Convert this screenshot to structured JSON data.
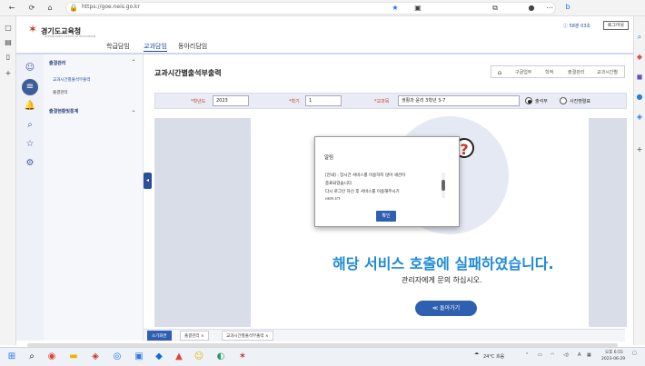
{
  "browser": {
    "url": "https://goe.neis.go.kr",
    "tab_label": "gae"
  },
  "header": {
    "logo": "경기도교육청",
    "logo_sub": "GYEONGGIDO OFFICE OF EDUCATION",
    "nav": [
      "학급담임",
      "교과담임",
      "동아리담임"
    ],
    "user": "ⓘ 58분 03초",
    "logout": "로그아웃"
  },
  "left_menu": {
    "section1": "출결관리",
    "items": [
      "교과시간별출석부출력",
      "출결관리"
    ],
    "section2": "출결현황및통계"
  },
  "page": {
    "title": "교과시간별출석부출력",
    "breadcrumb": [
      "구글업무",
      "학적",
      "출결관리",
      "교과시간별"
    ]
  },
  "filters": {
    "year_label": "*학년도",
    "year_value": "2023",
    "term_label": "*학기",
    "term_value": "1",
    "subject_label": "*교과목",
    "subject_value": "생활과 윤리 3학년 3-7",
    "radio1": "출석부",
    "radio2": "사진명렬표"
  },
  "error": {
    "title": "해당 서비스 호출에 실패하였습니다.",
    "subtitle": "관리자에게 문의 하십시오.",
    "back_button": "≪ 돌아가기"
  },
  "modal": {
    "title": "알림",
    "lines": [
      "[안내] : 장시간 서비스를 이용하지 않아 세션이",
      "종료되었습니다.",
      "다시 로그인 하신 후 서비스를 이용해주시기",
      "바랍니다."
    ],
    "ok": "확인"
  },
  "tabs": [
    "소기화면",
    "출결관리 ×",
    "교과시간별출석부출력 ×"
  ],
  "taskbar": {
    "weather": "24°C 흐음",
    "ime": "A",
    "time": "오후 6:55",
    "date": "2023-06-29"
  }
}
